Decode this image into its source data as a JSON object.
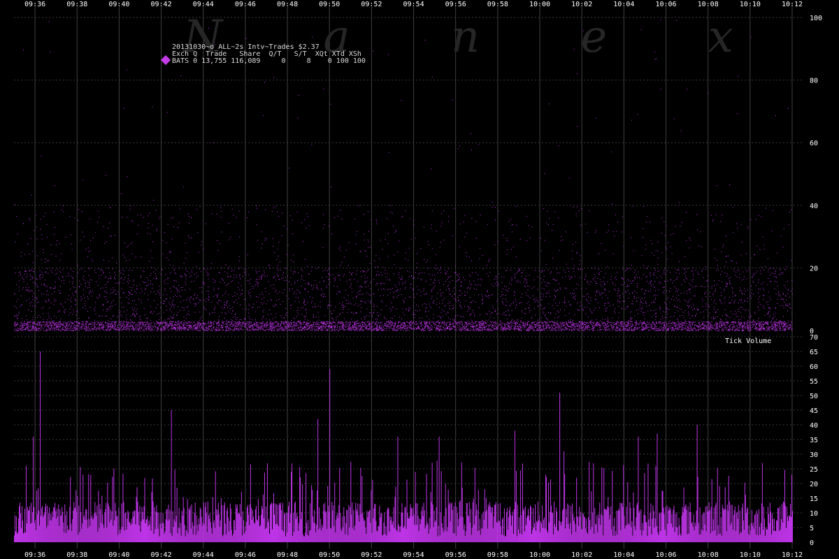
{
  "watermark": "N a n e x",
  "header": {
    "title": "20131030~o_ALL~2s Intv~Trades $2.37",
    "columns_line": "Exch Q  Trade   Share  Q/T   S/T  XQt XTd XSh",
    "row_line": "BATS 0 13,755 116,089     0     8    0 100 100"
  },
  "colors": {
    "series": "#bd34e6",
    "grid": "#404040",
    "bg": "#000000",
    "text": "#ffffff"
  },
  "chart_data": [
    {
      "type": "scatter",
      "title": "",
      "series": [
        {
          "name": "BATS",
          "color": "#bd34e6"
        }
      ],
      "y_ticks": [
        0,
        20,
        40,
        60,
        80,
        100
      ],
      "ylim": [
        0,
        100
      ],
      "x_ticks": [
        "09:36",
        "09:38",
        "09:40",
        "09:42",
        "09:44",
        "09:46",
        "09:48",
        "09:50",
        "09:52",
        "09:54",
        "09:56",
        "09:58",
        "10:00",
        "10:02",
        "10:04",
        "10:06",
        "10:08",
        "10:10",
        "10:12"
      ],
      "x_range": [
        "09:35",
        "10:12"
      ],
      "grid": true,
      "note_points": "dense cloud of points mostly between 0 and 20, sparse up to ~100"
    },
    {
      "type": "bar",
      "label": "Tick Volume",
      "ylim": [
        0,
        70
      ],
      "y_ticks": [
        0,
        5,
        10,
        15,
        20,
        25,
        30,
        35,
        40,
        45,
        50,
        55,
        60,
        65,
        70
      ],
      "x_ticks": [
        "09:36",
        "09:38",
        "09:40",
        "09:42",
        "09:44",
        "09:46",
        "09:48",
        "09:50",
        "09:52",
        "09:54",
        "09:56",
        "09:58",
        "10:00",
        "10:02",
        "10:04",
        "10:06",
        "10:08",
        "10:10",
        "10:12"
      ],
      "grid": true,
      "interval_seconds": 2,
      "peaks": [
        {
          "time": "09:36:14",
          "value": 65
        },
        {
          "time": "09:35:54",
          "value": 36
        },
        {
          "time": "09:42:28",
          "value": 45
        },
        {
          "time": "09:49:26",
          "value": 42
        },
        {
          "time": "09:50:00",
          "value": 59
        },
        {
          "time": "09:53:14",
          "value": 36
        },
        {
          "time": "09:55:12",
          "value": 36
        },
        {
          "time": "09:58:48",
          "value": 38
        },
        {
          "time": "10:00:56",
          "value": 51
        },
        {
          "time": "10:04:40",
          "value": 36
        },
        {
          "time": "10:05:34",
          "value": 37
        },
        {
          "time": "10:07:28",
          "value": 40
        },
        {
          "time": "10:01:08",
          "value": 31
        }
      ],
      "typical_range": [
        3,
        20
      ]
    }
  ]
}
